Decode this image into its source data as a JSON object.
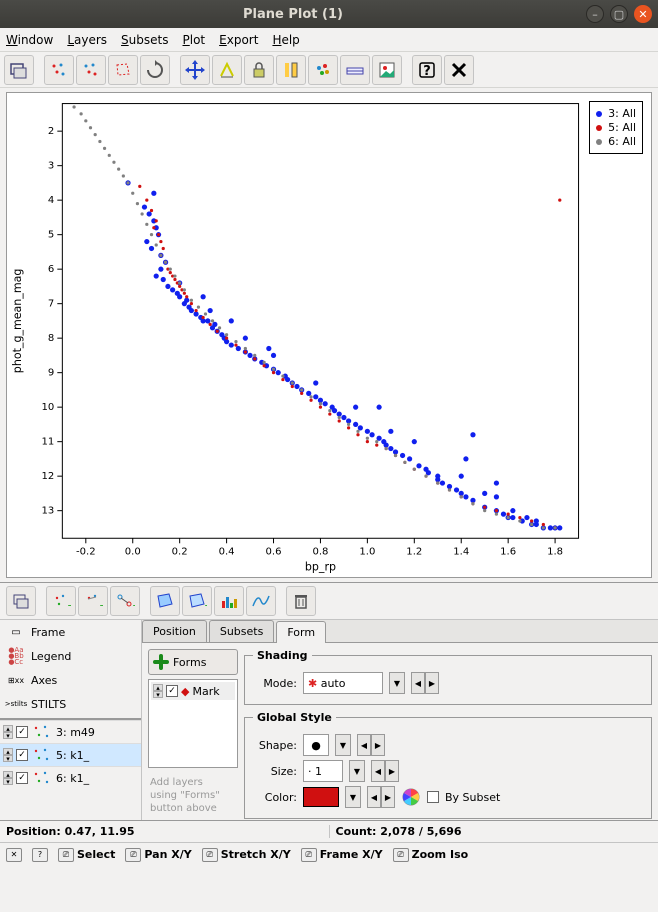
{
  "window": {
    "title": "Plane Plot (1)"
  },
  "menu": {
    "window": "Window",
    "layers": "Layers",
    "subsets": "Subsets",
    "plot": "Plot",
    "export": "Export",
    "help": "Help"
  },
  "chart_data": {
    "type": "scatter",
    "xlabel": "bp_rp",
    "ylabel": "phot_g_mean_mag",
    "xlim": [
      -0.3,
      1.9
    ],
    "ylim": [
      13.8,
      1.2
    ],
    "xticks": [
      -0.2,
      0.0,
      0.2,
      0.4,
      0.6,
      0.8,
      1.0,
      1.2,
      1.4,
      1.6,
      1.8
    ],
    "yticks": [
      2,
      3,
      4,
      5,
      6,
      7,
      8,
      9,
      10,
      11,
      12,
      13
    ],
    "series": [
      {
        "name": "3: All",
        "color": "#1020ee",
        "x": [
          -0.02,
          0.05,
          0.07,
          0.09,
          0.09,
          0.1,
          0.11,
          0.06,
          0.08,
          0.12,
          0.14,
          0.12,
          0.1,
          0.13,
          0.15,
          0.17,
          0.19,
          0.2,
          0.22,
          0.2,
          0.24,
          0.25,
          0.23,
          0.27,
          0.29,
          0.3,
          0.32,
          0.35,
          0.34,
          0.36,
          0.38,
          0.39,
          0.4,
          0.42,
          0.45,
          0.48,
          0.5,
          0.52,
          0.55,
          0.57,
          0.6,
          0.62,
          0.65,
          0.66,
          0.68,
          0.7,
          0.72,
          0.75,
          0.78,
          0.8,
          0.82,
          0.78,
          0.85,
          0.86,
          0.88,
          0.9,
          0.92,
          0.95,
          0.97,
          1.0,
          1.02,
          1.05,
          1.07,
          1.08,
          1.1,
          1.12,
          1.15,
          1.18,
          1.22,
          1.25,
          1.26,
          1.3,
          1.3,
          1.32,
          1.35,
          1.38,
          1.4,
          1.42,
          1.45,
          1.5,
          1.55,
          1.58,
          1.6,
          1.62,
          1.66,
          1.7,
          1.72,
          1.75,
          1.78,
          1.8,
          1.82,
          1.45,
          1.5,
          1.55,
          1.42,
          1.2,
          1.05,
          0.42,
          0.58,
          0.33,
          0.3,
          0.48,
          0.6,
          0.95,
          1.1,
          1.4,
          1.55,
          1.62,
          1.68,
          1.72
        ],
        "y": [
          3.5,
          4.2,
          4.4,
          4.6,
          3.8,
          4.8,
          5.0,
          5.2,
          5.4,
          5.6,
          5.8,
          6.0,
          6.2,
          6.3,
          6.5,
          6.6,
          6.7,
          6.8,
          7.0,
          6.4,
          7.1,
          7.2,
          6.9,
          7.3,
          7.4,
          7.5,
          7.5,
          7.6,
          7.7,
          7.8,
          7.9,
          8.0,
          8.1,
          8.2,
          8.3,
          8.4,
          8.5,
          8.6,
          8.7,
          8.8,
          8.9,
          9.0,
          9.1,
          9.2,
          9.3,
          9.4,
          9.5,
          9.6,
          9.7,
          9.8,
          9.9,
          9.3,
          10.0,
          10.1,
          10.2,
          10.3,
          10.4,
          10.5,
          10.6,
          10.7,
          10.8,
          10.9,
          11.0,
          11.1,
          11.2,
          11.3,
          11.4,
          11.5,
          11.7,
          11.8,
          11.9,
          12.0,
          12.1,
          12.2,
          12.3,
          12.4,
          12.5,
          12.6,
          12.7,
          12.9,
          13.0,
          13.1,
          13.2,
          13.2,
          13.3,
          13.4,
          13.4,
          13.5,
          13.5,
          13.5,
          13.5,
          10.8,
          12.5,
          12.2,
          11.5,
          11.0,
          10.0,
          7.5,
          8.3,
          7.2,
          6.8,
          8.0,
          8.5,
          10.0,
          10.7,
          12.0,
          12.6,
          13.0,
          13.2,
          13.3
        ]
      },
      {
        "name": "5: All",
        "color": "#d01010",
        "x": [
          0.03,
          0.06,
          0.08,
          0.1,
          0.09,
          0.11,
          0.12,
          0.13,
          0.12,
          0.14,
          0.15,
          0.16,
          0.17,
          0.18,
          0.19,
          0.2,
          0.21,
          0.22,
          0.23,
          0.25,
          0.27,
          0.3,
          0.33,
          0.36,
          0.4,
          0.44,
          0.48,
          0.52,
          0.56,
          0.6,
          0.64,
          0.68,
          0.72,
          0.76,
          0.8,
          0.84,
          0.88,
          0.92,
          0.96,
          1.0,
          1.04,
          1.08,
          1.12,
          1.16,
          1.2,
          1.25,
          1.3,
          1.35,
          1.4,
          1.45,
          1.5,
          1.55,
          1.6,
          1.65,
          1.7,
          1.75,
          1.8,
          1.82
        ],
        "y": [
          3.6,
          4.0,
          4.3,
          4.6,
          4.8,
          5.0,
          5.2,
          5.4,
          5.6,
          5.8,
          6.0,
          6.1,
          6.2,
          6.3,
          6.4,
          6.5,
          6.6,
          6.7,
          6.8,
          7.0,
          7.2,
          7.4,
          7.6,
          7.8,
          8.0,
          8.2,
          8.4,
          8.6,
          8.8,
          9.0,
          9.2,
          9.4,
          9.6,
          9.8,
          10.0,
          10.2,
          10.4,
          10.6,
          10.8,
          11.0,
          11.1,
          11.2,
          11.4,
          11.6,
          11.8,
          12.0,
          12.2,
          12.4,
          12.6,
          12.8,
          12.9,
          13.0,
          13.1,
          13.2,
          13.3,
          13.4,
          13.5,
          4.0
        ]
      },
      {
        "name": "6: All",
        "color": "#808080",
        "x": [
          -0.25,
          -0.22,
          -0.2,
          -0.18,
          -0.16,
          -0.14,
          -0.12,
          -0.1,
          -0.08,
          -0.06,
          -0.04,
          -0.02,
          0.0,
          0.02,
          0.04,
          0.06,
          0.08,
          0.1,
          0.12,
          0.14,
          0.16,
          0.18,
          0.2,
          0.22,
          0.25,
          0.28,
          0.31,
          0.34,
          0.37,
          0.4,
          0.44,
          0.48,
          0.52,
          0.56,
          0.6,
          0.64,
          0.68,
          0.72,
          0.76,
          0.8,
          0.84,
          0.88,
          0.92,
          0.96,
          1.0,
          1.04,
          1.08,
          1.12,
          1.16,
          1.2,
          1.25,
          1.3,
          1.35,
          1.4,
          1.45,
          1.5,
          1.55,
          1.6,
          1.65,
          1.7,
          1.75,
          1.8
        ],
        "y": [
          1.3,
          1.5,
          1.7,
          1.9,
          2.1,
          2.3,
          2.5,
          2.7,
          2.9,
          3.1,
          3.3,
          3.5,
          3.8,
          4.1,
          4.4,
          4.7,
          5.0,
          5.3,
          5.6,
          5.8,
          6.0,
          6.2,
          6.4,
          6.6,
          6.9,
          7.1,
          7.3,
          7.5,
          7.7,
          7.9,
          8.1,
          8.3,
          8.5,
          8.7,
          8.9,
          9.1,
          9.3,
          9.5,
          9.7,
          9.9,
          10.1,
          10.3,
          10.5,
          10.7,
          10.9,
          11.0,
          11.2,
          11.4,
          11.6,
          11.8,
          12.0,
          12.2,
          12.4,
          12.6,
          12.8,
          13.0,
          13.1,
          13.2,
          13.3,
          13.4,
          13.5,
          13.5
        ]
      }
    ]
  },
  "config_items": {
    "frame": "Frame",
    "legend": "Legend",
    "axes": "Axes",
    "stilts": "STILTS"
  },
  "layers": [
    {
      "label": "3: m49"
    },
    {
      "label": "5: k1_"
    },
    {
      "label": "6: k1_"
    }
  ],
  "tabs": {
    "position": "Position",
    "subsets": "Subsets",
    "form": "Form"
  },
  "forms_panel": {
    "button": "Forms",
    "mark_item": "Mark",
    "hint1": "Add layers",
    "hint2": "using \"Forms\"",
    "hint3": "button above"
  },
  "shading": {
    "title": "Shading",
    "mode_label": "Mode:",
    "mode_value": "auto"
  },
  "global_style": {
    "title": "Global Style",
    "shape_label": "Shape:",
    "size_label": "Size:",
    "size_value": "1",
    "color_label": "Color:",
    "color_value": "#d01010",
    "by_subset": "By Subset"
  },
  "status": {
    "position": "Position: 0.47, 11.95",
    "count": "Count: 2,078 / 5,696"
  },
  "navbar": {
    "select": "Select",
    "pan": "Pan X/Y",
    "stretch": "Stretch X/Y",
    "frame": "Frame X/Y",
    "zoom": "Zoom Iso"
  }
}
